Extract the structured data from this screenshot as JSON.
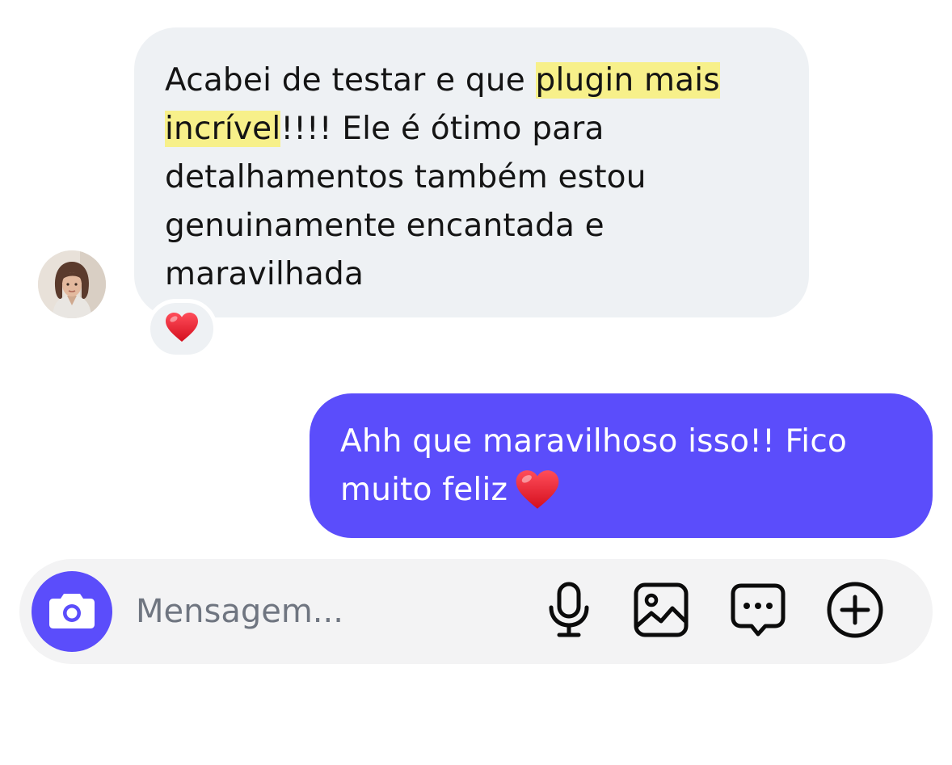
{
  "incoming": {
    "text_before": "Acabei de testar e que ",
    "highlight": "plugin mais incrível",
    "text_after": "!!!! Ele é ótimo para detalhamentos também estou genuinamente encantada e maravilhada",
    "reaction_icon": "red-heart-icon"
  },
  "outgoing": {
    "text": "Ahh que maravilhoso isso!! Fico muito feliz",
    "emoji_icon": "red-heart-icon"
  },
  "composer": {
    "placeholder": "Mensagem...",
    "icons": [
      "camera-icon",
      "microphone-icon",
      "image-icon",
      "sticker-message-icon",
      "plus-circle-icon"
    ]
  },
  "colors": {
    "accent": "#5b4dfb",
    "incoming_bubble": "#eef1f4",
    "highlight": "#f7f08a",
    "composer_bg": "#f3f3f4"
  }
}
